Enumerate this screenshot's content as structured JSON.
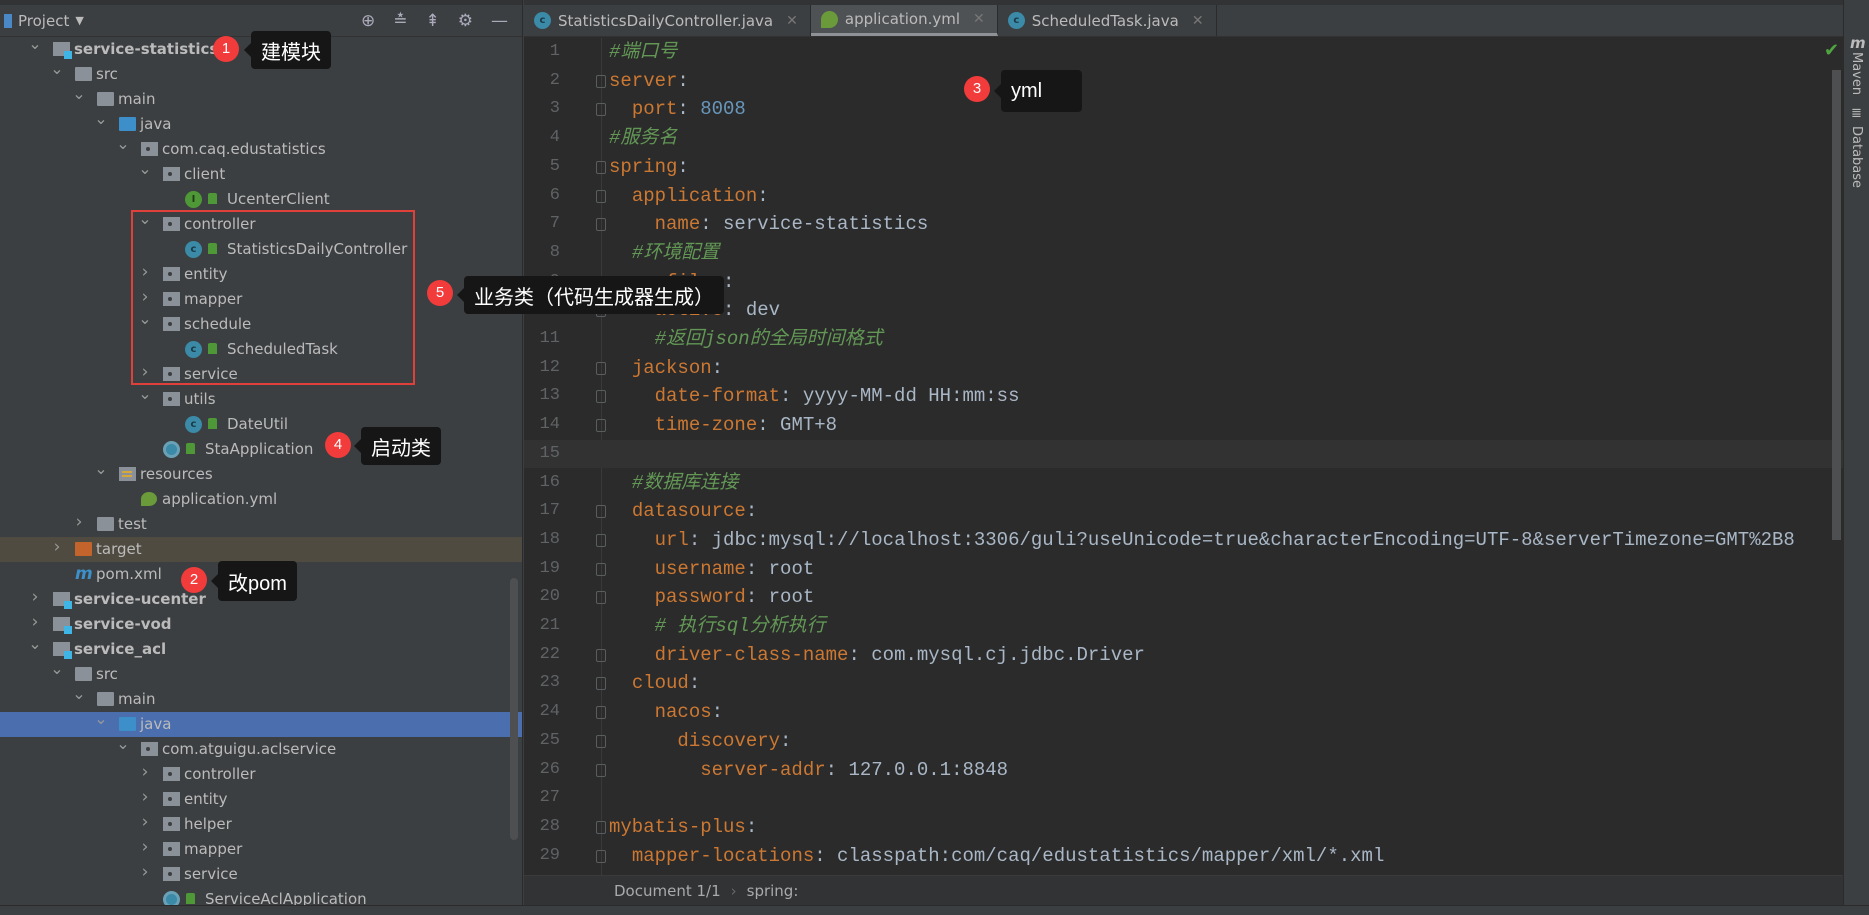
{
  "sidebar": {
    "title": "Project",
    "tree": [
      {
        "label": "service-statistics",
        "depth": 0,
        "icon": "module",
        "expanded": true,
        "bold": true
      },
      {
        "label": "src",
        "depth": 1,
        "icon": "folder",
        "expanded": true
      },
      {
        "label": "main",
        "depth": 2,
        "icon": "folder",
        "expanded": true
      },
      {
        "label": "java",
        "depth": 3,
        "icon": "source-folder",
        "expanded": true
      },
      {
        "label": "com.caq.edustatistics",
        "depth": 4,
        "icon": "package",
        "expanded": true
      },
      {
        "label": "client",
        "depth": 5,
        "icon": "package",
        "expanded": true
      },
      {
        "label": "UcenterClient",
        "depth": 6,
        "icon": "interface"
      },
      {
        "label": "controller",
        "depth": 5,
        "icon": "package",
        "expanded": true
      },
      {
        "label": "StatisticsDailyController",
        "depth": 6,
        "icon": "class"
      },
      {
        "label": "entity",
        "depth": 5,
        "icon": "package",
        "expanded": false
      },
      {
        "label": "mapper",
        "depth": 5,
        "icon": "package",
        "expanded": false
      },
      {
        "label": "schedule",
        "depth": 5,
        "icon": "package",
        "expanded": true
      },
      {
        "label": "ScheduledTask",
        "depth": 6,
        "icon": "class"
      },
      {
        "label": "service",
        "depth": 5,
        "icon": "package",
        "expanded": false
      },
      {
        "label": "utils",
        "depth": 5,
        "icon": "package",
        "expanded": true
      },
      {
        "label": "DateUtil",
        "depth": 6,
        "icon": "class"
      },
      {
        "label": "StaApplication",
        "depth": 5,
        "icon": "spring-app"
      },
      {
        "label": "resources",
        "depth": 3,
        "icon": "resources-folder",
        "expanded": true
      },
      {
        "label": "application.yml",
        "depth": 4,
        "icon": "yml"
      },
      {
        "label": "test",
        "depth": 2,
        "icon": "folder",
        "expanded": false
      },
      {
        "label": "target",
        "depth": 1,
        "icon": "excluded-folder",
        "expanded": false,
        "excluded": true
      },
      {
        "label": "pom.xml",
        "depth": 1,
        "icon": "maven"
      },
      {
        "label": "service-ucenter",
        "depth": 0,
        "icon": "module",
        "expanded": false,
        "bold": true
      },
      {
        "label": "service-vod",
        "depth": 0,
        "icon": "module",
        "expanded": false,
        "bold": true
      },
      {
        "label": "service_acl",
        "depth": 0,
        "icon": "module",
        "expanded": true,
        "bold": true
      },
      {
        "label": "src",
        "depth": 1,
        "icon": "folder",
        "expanded": true
      },
      {
        "label": "main",
        "depth": 2,
        "icon": "folder",
        "expanded": true
      },
      {
        "label": "java",
        "depth": 3,
        "icon": "source-folder",
        "expanded": true,
        "selected": true
      },
      {
        "label": "com.atguigu.aclservice",
        "depth": 4,
        "icon": "package",
        "expanded": true
      },
      {
        "label": "controller",
        "depth": 5,
        "icon": "package",
        "expanded": false
      },
      {
        "label": "entity",
        "depth": 5,
        "icon": "package",
        "expanded": false
      },
      {
        "label": "helper",
        "depth": 5,
        "icon": "package",
        "expanded": false
      },
      {
        "label": "mapper",
        "depth": 5,
        "icon": "package",
        "expanded": false
      },
      {
        "label": "service",
        "depth": 5,
        "icon": "package",
        "expanded": false
      },
      {
        "label": "ServiceAclApplication",
        "depth": 5,
        "icon": "spring-app"
      }
    ]
  },
  "tabs": [
    {
      "label": "StatisticsDailyController.java",
      "icon": "class",
      "active": false
    },
    {
      "label": "application.yml",
      "icon": "yml",
      "active": true
    },
    {
      "label": "ScheduledTask.java",
      "icon": "class",
      "active": false
    }
  ],
  "editor": {
    "current_line": 15,
    "lines": [
      "#端口号",
      "server:",
      "  port: 8008",
      "#服务名",
      "spring:",
      "  application:",
      "    name: service-statistics",
      "  #环境配置",
      "  profiles:",
      "    active: dev",
      "    #返回json的全局时间格式",
      "  jackson:",
      "    date-format: yyyy-MM-dd HH:mm:ss",
      "    time-zone: GMT+8",
      "",
      "  #数据库连接",
      "  datasource:",
      "    url: jdbc:mysql://localhost:3306/guli?useUnicode=true&characterEncoding=UTF-8&serverTimezone=GMT%2B8",
      "    username: root",
      "    password: root",
      "    # 执行sql分析执行",
      "    driver-class-name: com.mysql.cj.jdbc.Driver",
      "  cloud:",
      "    nacos:",
      "      discovery:",
      "        server-addr: 127.0.0.1:8848",
      "",
      "mybatis-plus:",
      "  mapper-locations: classpath:com/caq/edustatistics/mapper/xml/*.xml"
    ]
  },
  "breadcrumb": {
    "doc": "Document 1/1",
    "sep": "›",
    "path": "spring:"
  },
  "right_tools": {
    "maven": "Maven",
    "database": "Database"
  },
  "annotations": [
    {
      "num": "1",
      "text": "建模块"
    },
    {
      "num": "2",
      "text": "改pom"
    },
    {
      "num": "3",
      "text": "yml"
    },
    {
      "num": "4",
      "text": "启动类"
    },
    {
      "num": "5",
      "text": "业务类（代码生成器生成）"
    }
  ],
  "colors": {
    "key": "#cc7832",
    "comment": "#629755",
    "number": "#6897bb",
    "selection": "#4b6eaf",
    "annotation": "#f23b3b"
  }
}
